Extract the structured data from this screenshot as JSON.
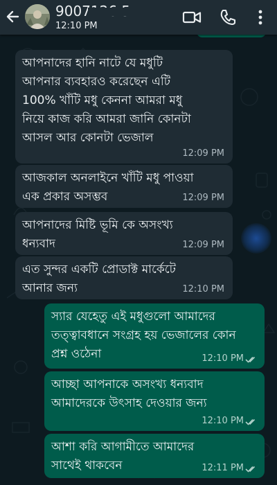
{
  "header": {
    "contact_name": "9007126    5",
    "status": "12:10 PM",
    "icons": {
      "back": "arrow-back-icon",
      "avatar": "contact-avatar",
      "video": "video-call-icon",
      "call": "phone-icon",
      "menu": "more-vertical-icon"
    }
  },
  "messages": [
    {
      "direction": "incoming",
      "text": "আপনাদের হানি নাটে যে মধুটি\nআপনার ব্যবহারও করেছেন এটি\n100% খাঁটি মধু কেননা আমরা মধু\nনিয়ে কাজ করি আমরা জানি কোনটা\nআসল আর কোনটা ভেজাল",
      "time": "12:09 PM"
    },
    {
      "direction": "incoming",
      "text": "আজকাল অনলাইনে খাঁটি মধু পাওয়া\nএক প্রকার  অসম্ভব",
      "time": "12:09 PM"
    },
    {
      "direction": "incoming",
      "text": "আপনাদের মিষ্টি ভূমি কে অসংখ্য\nধন্যবাদ",
      "time": "12:09 PM"
    },
    {
      "direction": "incoming",
      "text": "এত সুন্দর একটি প্রোডাক্ট মার্কেটে\nআনার জন্য",
      "time": "12:10 PM"
    },
    {
      "direction": "outgoing",
      "text": "স্যার যেহেতু এই মধুগুলো আমাদের\nতত্ত্বাবধানে সংগ্রহ হয় ভেজালের কোন\nপ্রশ্ন ওঠেনা",
      "time": "12:10 PM",
      "status": "read"
    },
    {
      "direction": "outgoing",
      "text": "আচ্ছা আপনাকে অসংখ্য ধন্যবাদ\nআমাদেরকে উৎসাহ দেওয়ার জন্য",
      "time": "12:10 PM",
      "status": "read"
    },
    {
      "direction": "outgoing",
      "text": "আশা করি আগামীতে আমাদের\nসাথেই থাকবেন",
      "time": "12:11 PM",
      "status": "read"
    }
  ],
  "colors": {
    "header_bg": "#1f2c34",
    "chat_bg": "#0d1a20",
    "incoming_bubble": "#1f2c34",
    "outgoing_bubble": "#005c4b",
    "text": "#e9edef",
    "timestamp": "#aebac1",
    "read_ticks": "#b3d3cc"
  }
}
